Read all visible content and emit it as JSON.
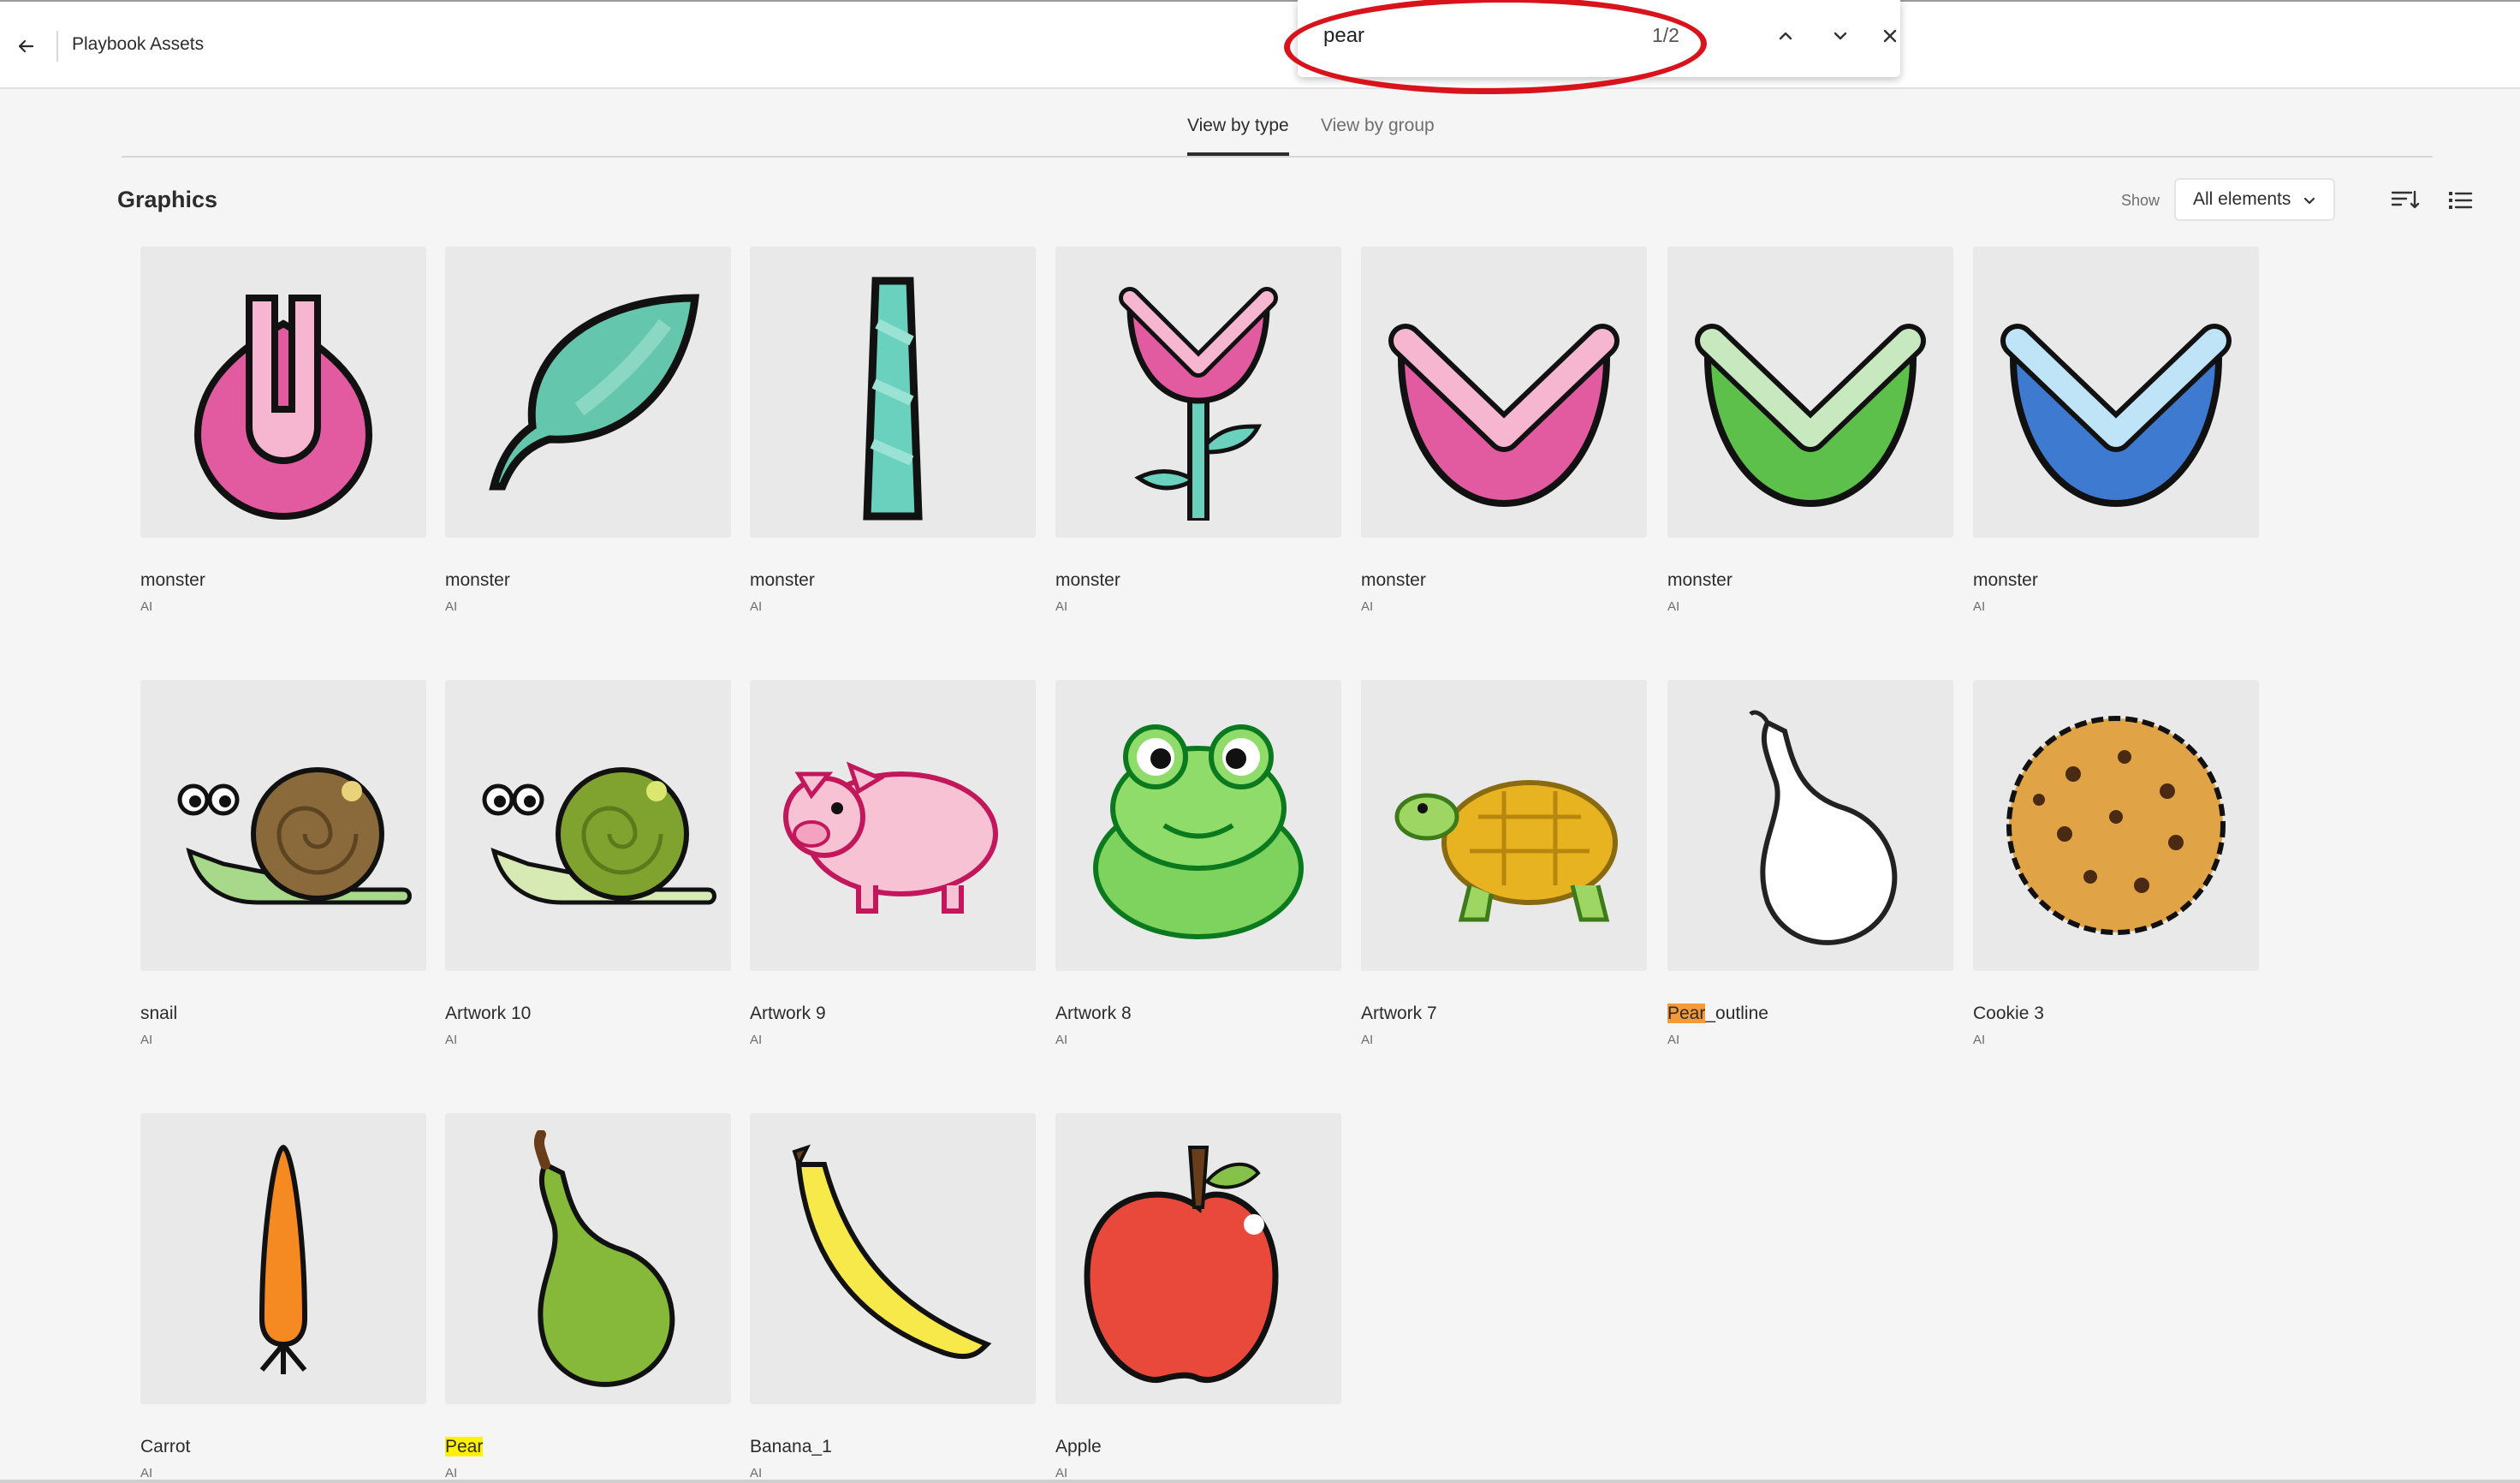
{
  "header": {
    "title": "Playbook Assets",
    "back_icon": "arrow-left-icon"
  },
  "find": {
    "query": "pear",
    "count": "1/2",
    "prev_icon": "chevron-up-icon",
    "next_icon": "chevron-down-icon",
    "close_icon": "close-icon"
  },
  "tabs": [
    {
      "label": "View by type",
      "active": true
    },
    {
      "label": "View by group",
      "active": false
    }
  ],
  "section": {
    "title": "Graphics",
    "show_label": "Show",
    "show_value": "All elements",
    "sort_icon": "sort-icon",
    "list_view_icon": "list-view-icon"
  },
  "assets": [
    {
      "name": "monster",
      "type": "AI",
      "icon": "monster-lip-icon"
    },
    {
      "name": "monster",
      "type": "AI",
      "icon": "leaf-icon"
    },
    {
      "name": "monster",
      "type": "AI",
      "icon": "stem-icon"
    },
    {
      "name": "monster",
      "type": "AI",
      "icon": "flytrap-flower-icon"
    },
    {
      "name": "monster",
      "type": "AI",
      "icon": "pink-mouth-icon"
    },
    {
      "name": "monster",
      "type": "AI",
      "icon": "green-mouth-icon"
    },
    {
      "name": "monster",
      "type": "AI",
      "icon": "blue-mouth-icon"
    },
    {
      "name": "snail",
      "type": "AI",
      "icon": "snail-icon"
    },
    {
      "name": "Artwork 10",
      "type": "AI",
      "icon": "green-snail-icon"
    },
    {
      "name": "Artwork 9",
      "type": "AI",
      "icon": "pig-icon"
    },
    {
      "name": "Artwork 8",
      "type": "AI",
      "icon": "frog-icon"
    },
    {
      "name": "Artwork 7",
      "type": "AI",
      "icon": "turtle-icon"
    },
    {
      "name": "Pear_outline",
      "type": "AI",
      "icon": "pear-outline-icon",
      "match": "Pear",
      "rest": "_outline",
      "highlight": "current"
    },
    {
      "name": "Cookie 3",
      "type": "AI",
      "icon": "cookie-icon"
    },
    {
      "name": "Carrot",
      "type": "AI",
      "icon": "carrot-icon"
    },
    {
      "name": "Pear",
      "type": "AI",
      "icon": "pear-icon",
      "match": "Pear",
      "rest": "",
      "highlight": "match"
    },
    {
      "name": "Banana_1",
      "type": "AI",
      "icon": "banana-icon"
    },
    {
      "name": "Apple",
      "type": "AI",
      "icon": "apple-icon"
    }
  ]
}
